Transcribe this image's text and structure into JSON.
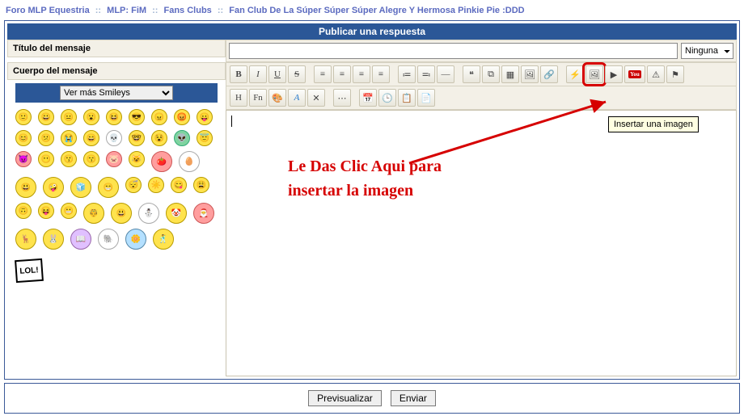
{
  "crumbs": {
    "a": "Foro MLP Equestria",
    "b": "MLP: FiM",
    "c": "Fans Clubs",
    "d": "Fan Club De La Súper Súper Súper Alegre Y Hermosa Pinkie Pie :DDD",
    "sep": "::"
  },
  "header": "Publicar una respuesta",
  "labels": {
    "subject": "Título del mensaje",
    "body": "Cuerpo del mensaje"
  },
  "subject": {
    "value": "",
    "icon_select": "Ninguna"
  },
  "smileys": {
    "more": "Ver más Smileys"
  },
  "toolbar": {
    "r1": [
      "B",
      "I",
      "U",
      "S",
      "",
      "L",
      "C",
      "R",
      "J",
      "",
      "UL",
      "OL",
      "HR",
      "",
      "Q",
      "CD",
      "TB",
      "IM",
      "LK",
      "",
      "FL",
      "IMG",
      "VD",
      "YT",
      "W",
      "SW"
    ],
    "r2": [
      "H",
      "Fn",
      "Cl",
      "A",
      "Rm",
      "",
      "Ot",
      "",
      "Dt",
      "Tm",
      "Pt",
      "Pg"
    ]
  },
  "tooltip": "Insertar una imagen",
  "annotation": {
    "l1": "Le Das Clic Aqui para",
    "l2": "insertar la imagen"
  },
  "buttons": {
    "preview": "Previsualizar",
    "submit": "Enviar"
  }
}
